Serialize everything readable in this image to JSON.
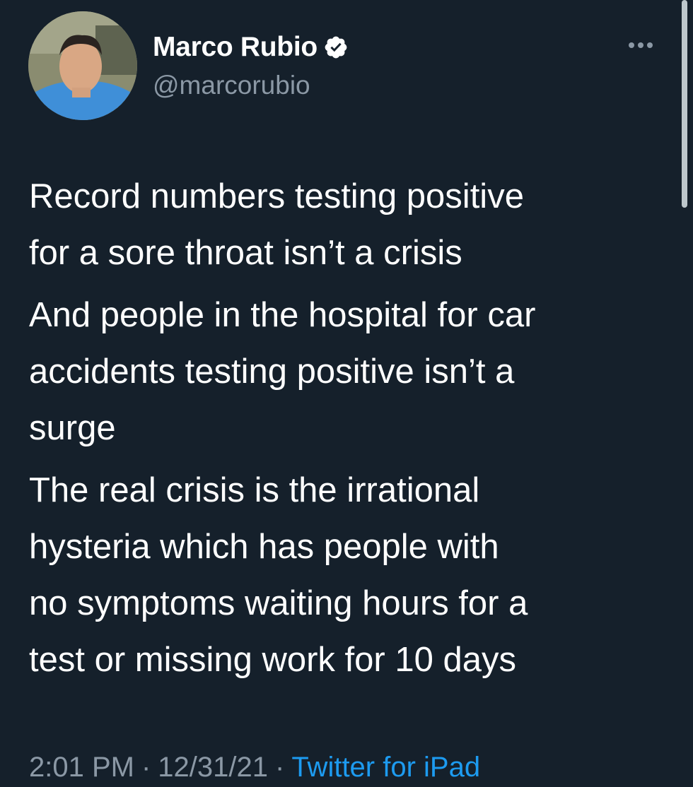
{
  "author": {
    "display_name": "Marco Rubio",
    "handle": "@marcorubio",
    "verified": true,
    "verified_icon": "verified-badge-icon",
    "avatar_icon": "avatar"
  },
  "more_icon": "more-options-icon",
  "tweet": {
    "paragraphs": [
      "Record numbers testing positive\nfor a sore throat isn’t a crisis",
      "And people in the hospital for car\naccidents testing positive isn’t a\nsurge",
      "The real crisis is the irrational\nhysteria which has people with\nno symptoms waiting hours for a\ntest or missing work for 10 days"
    ]
  },
  "meta": {
    "time": "2:01 PM",
    "date": "12/31/21",
    "separator": "·",
    "source": "Twitter for iPad"
  },
  "colors": {
    "background": "#15202b",
    "text": "#ffffff",
    "secondary_text": "#8b98a5",
    "accent": "#1d9bf0"
  }
}
